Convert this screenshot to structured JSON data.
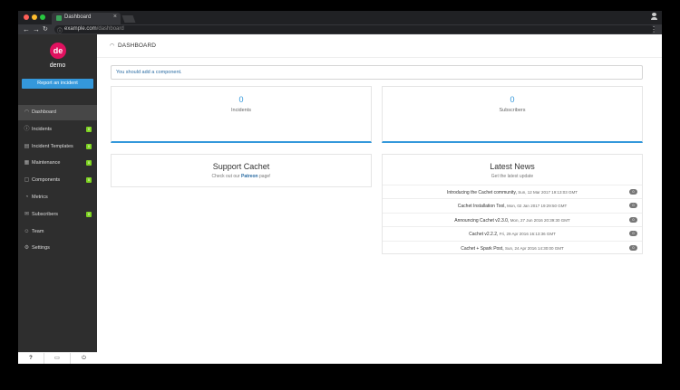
{
  "browser": {
    "tab_title": "Dashboard",
    "tab_close": "×",
    "url_host": "example.com",
    "url_path": "/dashboard",
    "colors": {
      "close": "#ff5f57",
      "minimize": "#febc2e",
      "maximize": "#28c840"
    }
  },
  "sidebar": {
    "avatar_initials": "de",
    "username": "demo",
    "report_button": "Report an incident",
    "items": [
      {
        "label": "Dashboard",
        "icon": "dashboard-icon",
        "glyph": "◠",
        "badge": "",
        "active": true
      },
      {
        "label": "Incidents",
        "icon": "alert-icon",
        "glyph": "ⓘ",
        "badge": "0",
        "active": false
      },
      {
        "label": "Incident Templates",
        "icon": "template-icon",
        "glyph": "▤",
        "badge": "0",
        "active": false
      },
      {
        "label": "Maintenance",
        "icon": "calendar-icon",
        "glyph": "▦",
        "badge": "0",
        "active": false
      },
      {
        "label": "Components",
        "icon": "component-icon",
        "glyph": "▢",
        "badge": "0",
        "active": false
      },
      {
        "label": "Metrics",
        "icon": "metrics-icon",
        "glyph": "◔",
        "badge": "",
        "active": false
      },
      {
        "label": "Subscribers",
        "icon": "mail-icon",
        "glyph": "✉",
        "badge": "0",
        "active": false
      },
      {
        "label": "Team",
        "icon": "team-icon",
        "glyph": "☺",
        "badge": "",
        "active": false
      },
      {
        "label": "Settings",
        "icon": "gear-icon",
        "glyph": "⚙",
        "badge": "",
        "active": false
      }
    ],
    "footer": [
      "?",
      "▭",
      "⏻"
    ]
  },
  "main": {
    "page_title": "DASHBOARD",
    "alert": "You should add a component.",
    "stats": [
      {
        "value": "0",
        "label": "Incidents"
      },
      {
        "value": "0",
        "label": "Subscribers"
      }
    ],
    "support": {
      "title": "Support Cachet",
      "text_before": "Check out our ",
      "link": "Patreon",
      "text_after": " page!"
    },
    "news": {
      "title": "Latest News",
      "subtitle": "Get the latest update",
      "items": [
        {
          "title": "Introducing the Cachet community,",
          "date": "Sun, 12 Mar 2017 19:13:03 GMT",
          "count": "0"
        },
        {
          "title": "Cachet Installation Tool,",
          "date": "Mon, 02 Jan 2017 19:29:50 GMT",
          "count": "0"
        },
        {
          "title": "Announcing Cachet v2.3.0,",
          "date": "Mon, 27 Jun 2016 20:39:30 GMT",
          "count": "0"
        },
        {
          "title": "Cachet v2.2.2,",
          "date": "Fri, 29 Apr 2016 16:13:36 GMT",
          "count": "0"
        },
        {
          "title": "Cachet + Spark Post,",
          "date": "Sun, 24 Apr 2016 14:30:00 GMT",
          "count": "0"
        }
      ]
    }
  }
}
